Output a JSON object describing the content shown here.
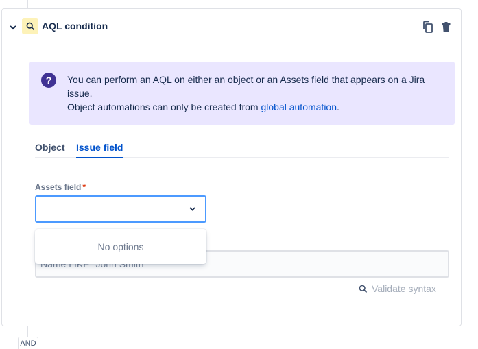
{
  "condition": {
    "title": "AQL condition",
    "icon": "search-icon"
  },
  "info": {
    "line1": "You can perform an AQL on either an object or an Assets field that appears on a Jira issue.",
    "line2_prefix": "Object automations can only be created from ",
    "line2_link": "global automation",
    "line2_suffix": "."
  },
  "tabs": [
    {
      "label": "Object",
      "selected": false
    },
    {
      "label": "Issue field",
      "selected": true
    }
  ],
  "assets_field": {
    "label": "Assets field",
    "required_marker": "*",
    "value": "",
    "dropdown_message": "No options"
  },
  "aql_input": {
    "placeholder": "Name LIKE \"John Smith\"",
    "value": ""
  },
  "validate": {
    "label": "Validate syntax"
  },
  "connector": {
    "label": "AND"
  },
  "colors": {
    "accent": "#0052cc",
    "info_background": "#eae6ff",
    "info_icon": "#403294",
    "condition_icon_background": "#fdf2b8",
    "required": "#de350b"
  }
}
